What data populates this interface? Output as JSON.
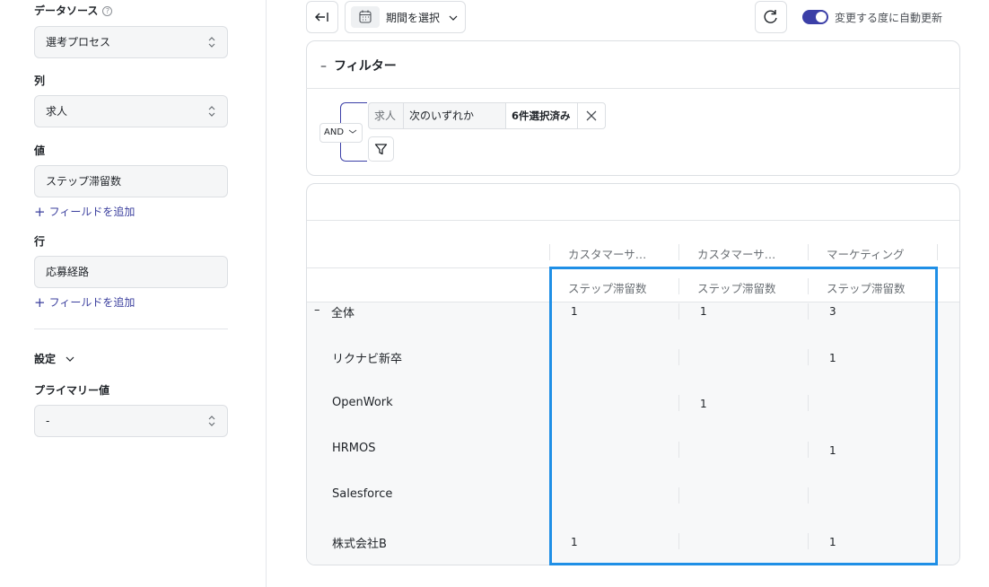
{
  "sidebar": {
    "data_source": {
      "label": "データソース",
      "help": "?",
      "value": "選考プロセス"
    },
    "columns": {
      "label": "列",
      "value": "求人"
    },
    "values": {
      "label": "値",
      "value": "ステップ滞留数",
      "add_field": "フィールドを追加"
    },
    "rows": {
      "label": "行",
      "value": "応募経路",
      "add_field": "フィールドを追加"
    },
    "settings": {
      "label": "設定"
    },
    "primary": {
      "label": "プライマリー値",
      "value": "-"
    }
  },
  "toolbar": {
    "period": "期間を選択",
    "auto_refresh_label": "変更する度に自動更新",
    "auto_refresh_on": true
  },
  "filter": {
    "title": "フィルター",
    "toggle": "–",
    "logic": "AND",
    "field": "求人",
    "operator": "次のいずれか",
    "selection": "6件選択済み"
  },
  "table": {
    "columns": [
      "カスタマーサ…",
      "カスタマーサ…",
      "マーケティング"
    ],
    "metric": "ステップ滞留数",
    "total_row": {
      "toggle": "–",
      "label": "全体",
      "values": [
        "1",
        "1",
        "3"
      ]
    },
    "rows": [
      {
        "label": "リクナビ新卒",
        "values": [
          "",
          "",
          "1"
        ]
      },
      {
        "label": "OpenWork",
        "values": [
          "",
          "1",
          ""
        ]
      },
      {
        "label": "HRMOS",
        "values": [
          "",
          "",
          "1"
        ]
      },
      {
        "label": "Salesforce",
        "values": [
          "",
          "",
          ""
        ]
      },
      {
        "label": "株式会社B",
        "values": [
          "1",
          "",
          "1"
        ]
      }
    ]
  },
  "colors": {
    "accent": "#3b3fa7",
    "highlight": "#1f8fe6"
  }
}
